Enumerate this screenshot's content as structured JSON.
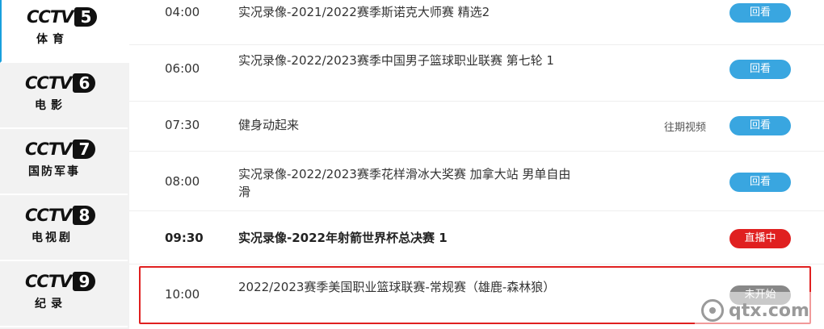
{
  "sidebar": {
    "channels": [
      {
        "logo_text": "CCTV",
        "number": "5",
        "name": "体育"
      },
      {
        "logo_text": "CCTV",
        "number": "6",
        "name": "电影"
      },
      {
        "logo_text": "CCTV",
        "number": "7",
        "name": "国防军事"
      },
      {
        "logo_text": "CCTV",
        "number": "8",
        "name": "电视剧"
      },
      {
        "logo_text": "CCTV",
        "number": "9",
        "name": "纪录"
      }
    ]
  },
  "schedule": [
    {
      "time": "04:00",
      "title": "实况录像-2021/2022赛季斯诺克大师赛 精选2",
      "past_link": "",
      "button": "回看",
      "status": "replay"
    },
    {
      "time": "06:00",
      "title": "实况录像-2022/2023赛季中国男子篮球职业联赛 第七轮 1",
      "past_link": "",
      "button": "回看",
      "status": "replay"
    },
    {
      "time": "07:30",
      "title": "健身动起来",
      "past_link": "往期视频",
      "button": "回看",
      "status": "replay"
    },
    {
      "time": "08:00",
      "title": "实况录像-2022/2023赛季花样滑冰大奖赛 加拿大站 男单自由滑",
      "past_link": "",
      "button": "回看",
      "status": "replay"
    },
    {
      "time": "09:30",
      "title": "实况录像-2022年射箭世界杯总决赛 1",
      "past_link": "",
      "button": "直播中",
      "status": "live"
    },
    {
      "time": "10:00",
      "title": "2022/2023赛季美国职业篮球联赛-常规赛（雄鹿-森林狼）",
      "past_link": "",
      "button": "未开始",
      "status": "upcoming"
    }
  ],
  "watermark": {
    "text": "qtx.com"
  },
  "colors": {
    "replay": "#39a6e0",
    "live": "#e02020",
    "upcoming": "#888888",
    "highlight": "#e02020"
  }
}
